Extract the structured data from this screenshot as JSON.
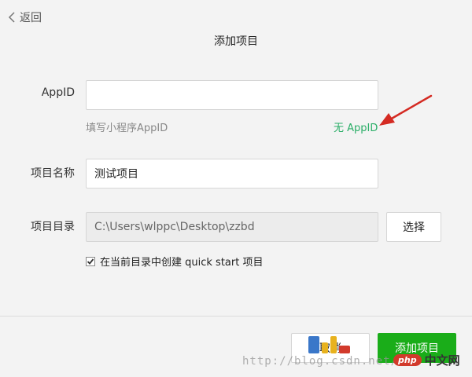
{
  "header": {
    "back_label": "返回",
    "title": "添加项目"
  },
  "form": {
    "appid": {
      "label": "AppID",
      "value": "",
      "hint": "填写小程序AppID",
      "no_appid_link": "无 AppID"
    },
    "project_name": {
      "label": "项目名称",
      "value": "测试项目"
    },
    "project_dir": {
      "label": "项目目录",
      "value": "C:\\Users\\wlppc\\Desktop\\zzbd",
      "choose_button": "选择"
    },
    "quick_start": {
      "checked": true,
      "label": "在当前目录中创建 quick start 项目"
    }
  },
  "footer": {
    "cancel_label": "取消",
    "add_label": "添加项目"
  },
  "watermark": {
    "url": "http://blog.csdn.net/",
    "badge_php": "php",
    "badge_cn": "中文网"
  },
  "colors": {
    "accent_green": "#1aad19",
    "link_green": "#2aae67",
    "annotation_arrow": "#d42a22"
  }
}
